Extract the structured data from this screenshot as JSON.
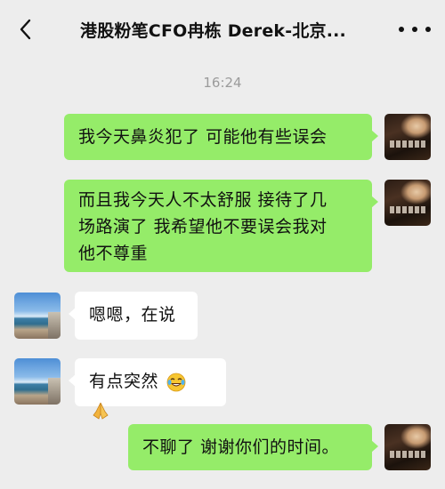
{
  "nav": {
    "title": "港股粉笔CFO冉栋 Derek-北京...",
    "back_icon": "chevron-left-icon",
    "more_icon": "more-dots-icon"
  },
  "chat": {
    "timestamp": "16:24",
    "messages": [
      {
        "from": "self",
        "text": "我今天鼻炎犯了 可能他有些误会"
      },
      {
        "from": "self",
        "lines": [
          "而且我今天人不太舒服 接待了几",
          "场路演了 我希望他不要误会我对",
          "他不尊重"
        ]
      },
      {
        "from": "other",
        "text": "嗯嗯，在说"
      },
      {
        "from": "other",
        "text": "有点突然",
        "emojis": [
          "laughing-tears-emoji",
          "praying-hands-emoji"
        ]
      },
      {
        "from": "self",
        "text": "不聊了 谢谢你们的时间。"
      }
    ]
  },
  "colors": {
    "background": "#ededed",
    "self_bubble": "#95ec69",
    "other_bubble": "#ffffff",
    "timestamp_text": "#9b9b9b"
  }
}
